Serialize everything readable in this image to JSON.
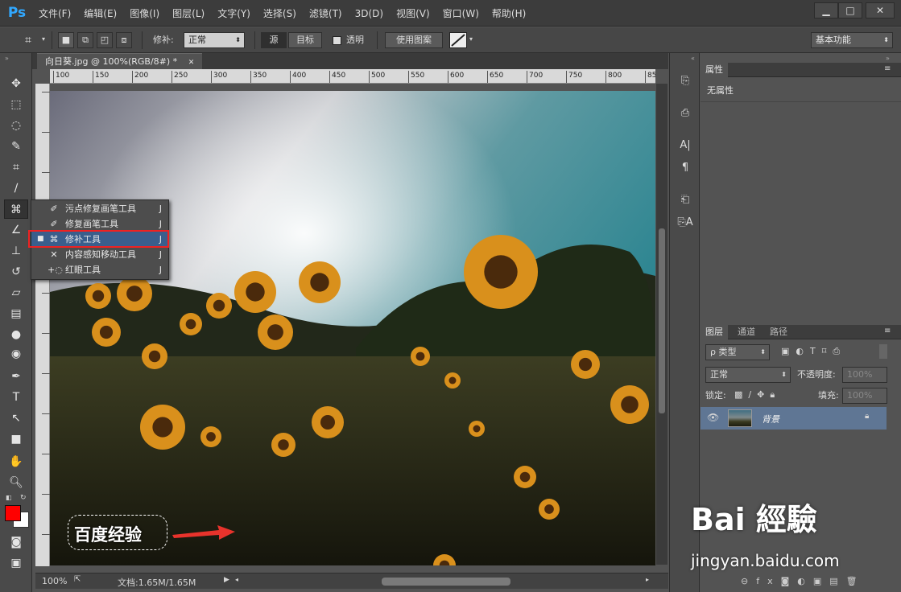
{
  "app": {
    "logo": "Ps"
  },
  "menu": [
    "文件(F)",
    "编辑(E)",
    "图像(I)",
    "图层(L)",
    "文字(Y)",
    "选择(S)",
    "滤镜(T)",
    "3D(D)",
    "视图(V)",
    "窗口(W)",
    "帮助(H)"
  ],
  "window_controls": [
    "▁",
    "□",
    "✕"
  ],
  "options": {
    "patch_label": "修补:",
    "patch_mode": "正常",
    "source_label": "源",
    "target_label": "目标",
    "transparent_label": "透明",
    "use_pattern_label": "使用图案",
    "workspace": "基本功能"
  },
  "document": {
    "tab_title": "向日葵.jpg @ 100%(RGB/8#) *",
    "ruler_ticks": [
      "100",
      "150",
      "200",
      "250",
      "300",
      "350",
      "400",
      "450",
      "500",
      "550",
      "600",
      "650",
      "700",
      "750",
      "800",
      "85"
    ],
    "zoom": "100%",
    "doc_info": "文档:1.65M/1.65M"
  },
  "tool_menu": [
    {
      "label": "污点修复画笔工具",
      "key": "J",
      "icon": "spot-healing-brush-icon",
      "selected": false
    },
    {
      "label": "修复画笔工具",
      "key": "J",
      "icon": "healing-brush-icon",
      "selected": false
    },
    {
      "label": "修补工具",
      "key": "J",
      "icon": "patch-icon",
      "selected": true
    },
    {
      "label": "内容感知移动工具",
      "key": "J",
      "icon": "content-aware-move-icon",
      "selected": false
    },
    {
      "label": "红眼工具",
      "key": "J",
      "icon": "red-eye-icon",
      "selected": false
    }
  ],
  "properties": {
    "tab": "属性",
    "empty_text": "无属性"
  },
  "layers": {
    "tabs": [
      "图层",
      "通道",
      "路径"
    ],
    "filter_label": "ρ 类型",
    "blend_mode": "正常",
    "opacity_label": "不透明度:",
    "opacity_value": "100%",
    "lock_label": "锁定:",
    "fill_label": "填充:",
    "fill_value": "100%",
    "layer_name": "背景"
  },
  "colors": {
    "foreground": "#ff0000",
    "background": "#ffffff",
    "accent": "#31a8ff"
  },
  "watermark": {
    "caption": "百度经验",
    "brand": "Bai 經驗",
    "url": "jingyan.baidu.com"
  }
}
